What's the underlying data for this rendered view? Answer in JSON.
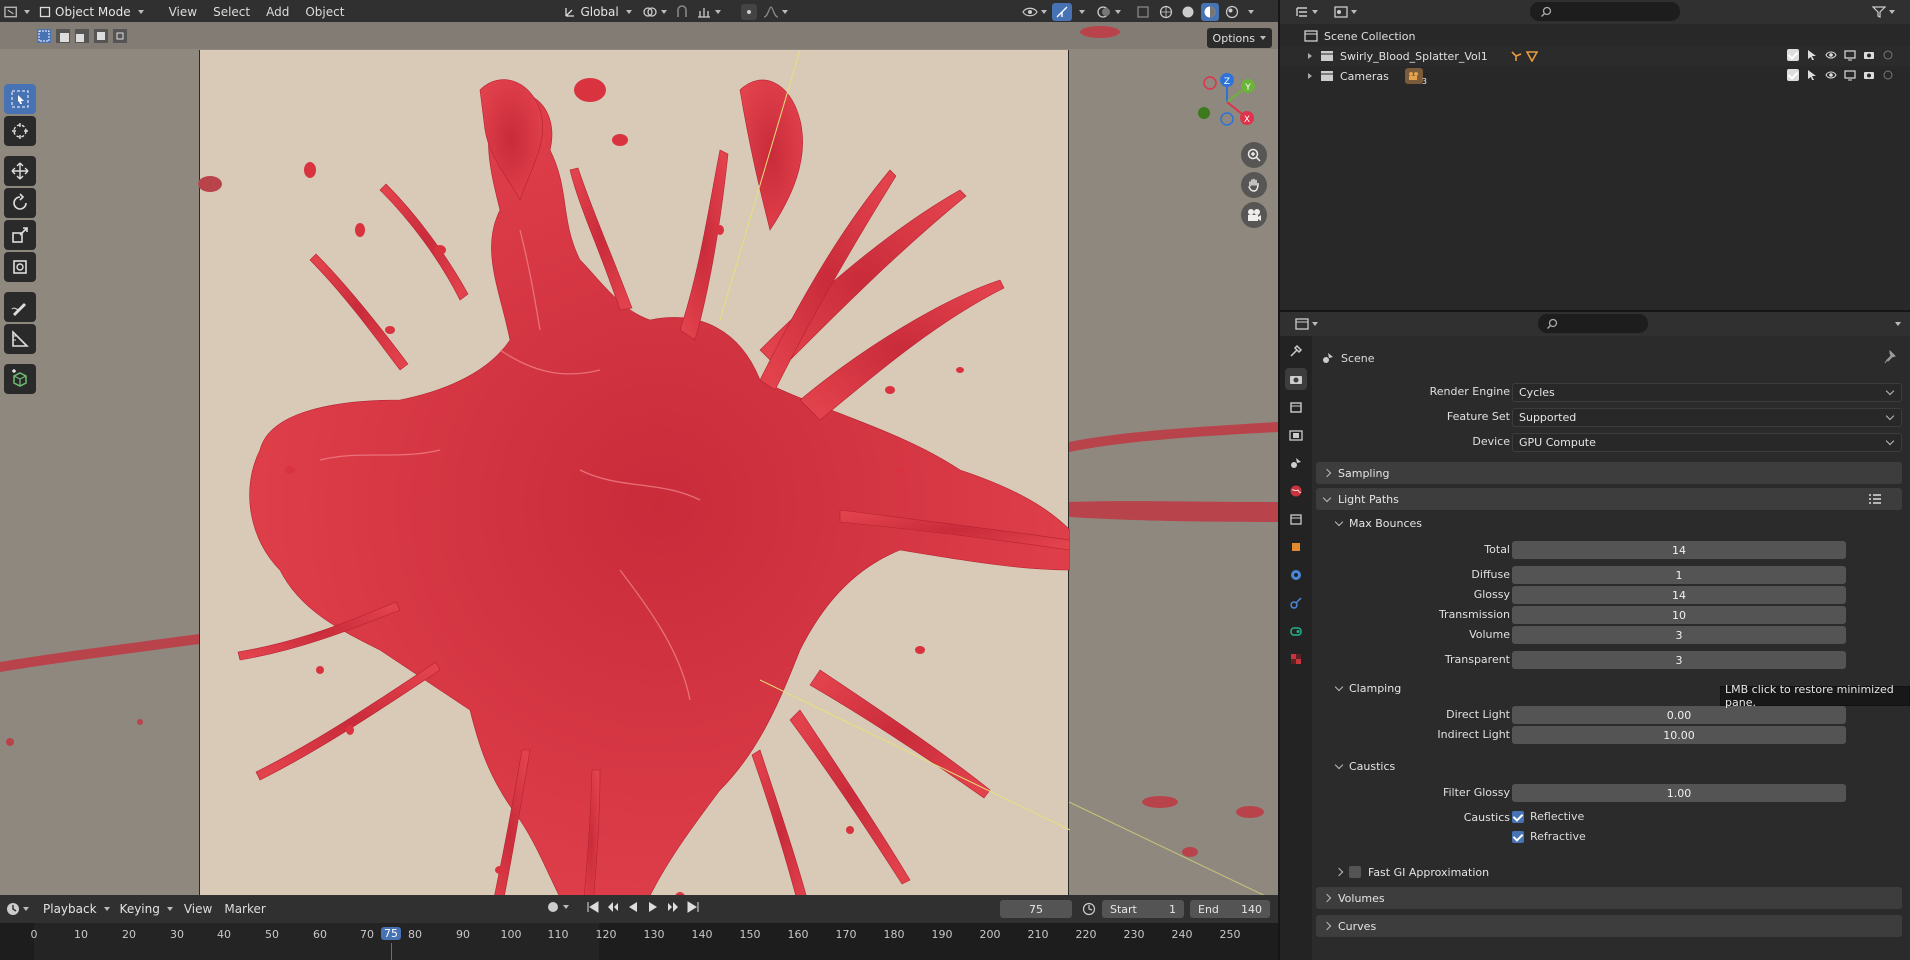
{
  "viewport": {
    "mode": "Object Mode",
    "menu": [
      "View",
      "Select",
      "Add",
      "Object"
    ],
    "transform_orientation": "Global",
    "options_label": "Options",
    "gizmo_axes": [
      "Z",
      "Y",
      "X"
    ]
  },
  "timeline": {
    "menus": [
      "Playback",
      "Keying",
      "View",
      "Marker"
    ],
    "current_frame": "75",
    "start_label": "Start",
    "start_value": "1",
    "end_label": "End",
    "end_value": "140",
    "ticks": [
      "0",
      "10",
      "20",
      "30",
      "40",
      "50",
      "60",
      "70",
      "75",
      "80",
      "90",
      "100",
      "110",
      "120",
      "130",
      "140",
      "150",
      "160",
      "170",
      "180",
      "190",
      "200",
      "210",
      "220",
      "230",
      "240",
      "250"
    ]
  },
  "outliner": {
    "root": "Scene Collection",
    "items": [
      {
        "label": "Swirly_Blood_Splatter_Vol1"
      },
      {
        "label": "Cameras",
        "badge": "3"
      }
    ]
  },
  "properties": {
    "context": "Scene",
    "render_engine_label": "Render Engine",
    "render_engine": "Cycles",
    "feature_set_label": "Feature Set",
    "feature_set": "Supported",
    "device_label": "Device",
    "device": "GPU Compute",
    "sampling_label": "Sampling",
    "light_paths_label": "Light Paths",
    "max_bounces_label": "Max Bounces",
    "bounces": [
      {
        "label": "Total",
        "value": "14"
      },
      {
        "label": "Diffuse",
        "value": "1"
      },
      {
        "label": "Glossy",
        "value": "14"
      },
      {
        "label": "Transmission",
        "value": "10"
      },
      {
        "label": "Volume",
        "value": "3"
      },
      {
        "label": "Transparent",
        "value": "3"
      }
    ],
    "clamping_label": "Clamping",
    "clamping": [
      {
        "label": "Direct Light",
        "value": "0.00"
      },
      {
        "label": "Indirect Light",
        "value": "10.00"
      }
    ],
    "caustics_panel_label": "Caustics",
    "filter_glossy_label": "Filter Glossy",
    "filter_glossy": "1.00",
    "caustics_label": "Caustics",
    "reflective_label": "Reflective",
    "refractive_label": "Refractive",
    "fast_gi_label": "Fast GI Approximation",
    "volumes_label": "Volumes",
    "curves_label": "Curves"
  },
  "tooltip": "LMB click to restore minimized pane.",
  "colors": {
    "accent": "#4772b3",
    "blood": "#d8333f",
    "backdrop": "#d9cab8"
  }
}
